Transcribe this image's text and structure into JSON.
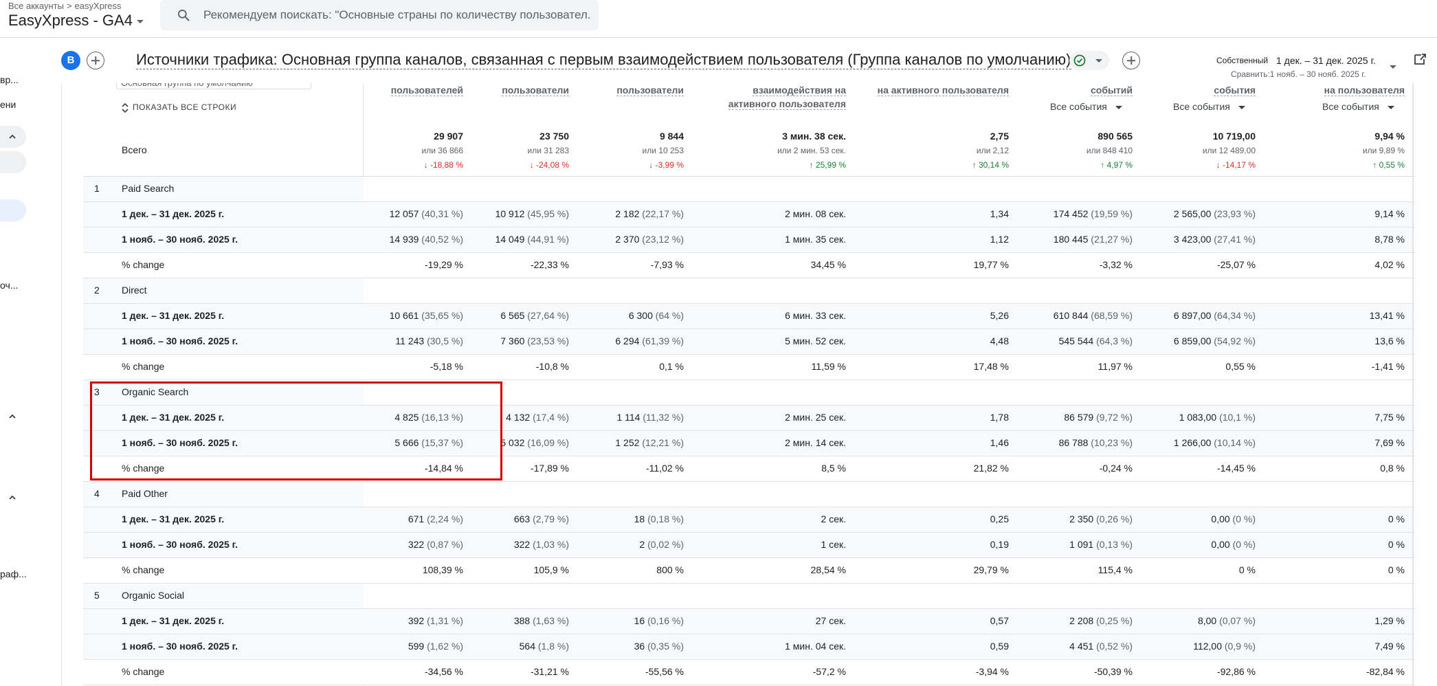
{
  "topbar": {
    "breadcrumb_root": "Все аккаунты",
    "breadcrumb_sep": ">",
    "breadcrumb_account": "easyXpress",
    "property": "EasyXpress - GA4",
    "search_placeholder": "Рекомендуем поискать: \"Основные страны по количеству пользовател..."
  },
  "rail": {
    "labels": [
      "вр...",
      "ени",
      "оч...",
      "раф..."
    ]
  },
  "report": {
    "avatar": "B",
    "title": "Источники трафика: Основная группа каналов, связанная с первым взаимодействием пользователя (Группа каналов по умолчанию)",
    "date_range_label": "Собственный",
    "date_range": "1 дек. – 31 дек. 2025 г.",
    "compare": "Сравнить:1 нояб. – 30 нояб. 2025 г."
  },
  "table": {
    "partial_dimension": "Основная группа по умолчанию",
    "show_all_rows": "ПОКАЗАТЬ ВСЕ СТРОКИ",
    "total_label": "Всего",
    "headers": [
      {
        "lines": [
          "пользователей"
        ]
      },
      {
        "lines": [
          "пользователи"
        ]
      },
      {
        "lines": [
          "пользователи"
        ]
      },
      {
        "lines": [
          "взаимодействия на",
          "активного пользователя"
        ]
      },
      {
        "lines": [
          "на активного пользователя"
        ]
      },
      {
        "lines": [
          "событий"
        ],
        "dropdown": "Все события"
      },
      {
        "lines": [
          "события"
        ],
        "dropdown": "Все события"
      },
      {
        "lines": [
          "на пользователя"
        ],
        "dropdown": "Все события"
      }
    ],
    "totals": [
      {
        "value": "29 907",
        "prev": "или 36 866",
        "change": "↓ -18,88 %",
        "dir": "down"
      },
      {
        "value": "23 750",
        "prev": "или 31 283",
        "change": "↓ -24,08 %",
        "dir": "down"
      },
      {
        "value": "9 844",
        "prev": "или 10 253",
        "change": "↓ -3,99 %",
        "dir": "down"
      },
      {
        "value": "3 мин. 38 сек.",
        "prev": "или 2 мин. 53 сек.",
        "change": "↑ 25,99 %",
        "dir": "up"
      },
      {
        "value": "2,75",
        "prev": "или 2,12",
        "change": "↑ 30,14 %",
        "dir": "up"
      },
      {
        "value": "890 565",
        "prev": "или 848 410",
        "change": "↑ 4,97 %",
        "dir": "up"
      },
      {
        "value": "10 719,00",
        "prev": "или 12 489,00",
        "change": "↓ -14,17 %",
        "dir": "down"
      },
      {
        "value": "9,94 %",
        "prev": "или 9,89 %",
        "change": "↑ 0,55 %",
        "dir": "up"
      }
    ],
    "groups": [
      {
        "num": "1",
        "name": "Paid Search",
        "rows": [
          {
            "label": "1 дек. – 31 дек. 2025 г.",
            "cells": [
              [
                "12 057",
                "(40,31 %)"
              ],
              [
                "10 912",
                "(45,95 %)"
              ],
              [
                "2 182",
                "(22,17 %)"
              ],
              [
                "2 мин. 08 сек.",
                ""
              ],
              [
                "1,34",
                ""
              ],
              [
                "174 452",
                "(19,59 %)"
              ],
              [
                "2 565,00",
                "(23,93 %)"
              ],
              [
                "9,14 %",
                ""
              ]
            ]
          },
          {
            "label": "1 нояб. – 30 нояб. 2025 г.",
            "cells": [
              [
                "14 939",
                "(40,52 %)"
              ],
              [
                "14 049",
                "(44,91 %)"
              ],
              [
                "2 370",
                "(23,12 %)"
              ],
              [
                "1 мин. 35 сек.",
                ""
              ],
              [
                "1,12",
                ""
              ],
              [
                "180 445",
                "(21,27 %)"
              ],
              [
                "3 423,00",
                "(27,41 %)"
              ],
              [
                "8,78 %",
                ""
              ]
            ]
          },
          {
            "label": "% change",
            "cells": [
              [
                "-19,29 %",
                ""
              ],
              [
                "-22,33 %",
                ""
              ],
              [
                "-7,93 %",
                ""
              ],
              [
                "34,45 %",
                ""
              ],
              [
                "19,77 %",
                ""
              ],
              [
                "-3,32 %",
                ""
              ],
              [
                "-25,07 %",
                ""
              ],
              [
                "4,02 %",
                ""
              ]
            ]
          }
        ]
      },
      {
        "num": "2",
        "name": "Direct",
        "rows": [
          {
            "label": "1 дек. – 31 дек. 2025 г.",
            "cells": [
              [
                "10 661",
                "(35,65 %)"
              ],
              [
                "6 565",
                "(27,64 %)"
              ],
              [
                "6 300",
                "(64 %)"
              ],
              [
                "6 мин. 33 сек.",
                ""
              ],
              [
                "5,26",
                ""
              ],
              [
                "610 844",
                "(68,59 %)"
              ],
              [
                "6 897,00",
                "(64,34 %)"
              ],
              [
                "13,41 %",
                ""
              ]
            ]
          },
          {
            "label": "1 нояб. – 30 нояб. 2025 г.",
            "cells": [
              [
                "11 243",
                "(30,5 %)"
              ],
              [
                "7 360",
                "(23,53 %)"
              ],
              [
                "6 294",
                "(61,39 %)"
              ],
              [
                "5 мин. 52 сек.",
                ""
              ],
              [
                "4,48",
                ""
              ],
              [
                "545 544",
                "(64,3 %)"
              ],
              [
                "6 859,00",
                "(54,92 %)"
              ],
              [
                "13,6 %",
                ""
              ]
            ]
          },
          {
            "label": "% change",
            "cells": [
              [
                "-5,18 %",
                ""
              ],
              [
                "-10,8 %",
                ""
              ],
              [
                "0,1 %",
                ""
              ],
              [
                "11,59 %",
                ""
              ],
              [
                "17,48 %",
                ""
              ],
              [
                "11,97 %",
                ""
              ],
              [
                "0,55 %",
                ""
              ],
              [
                "-1,41 %",
                ""
              ]
            ]
          }
        ]
      },
      {
        "num": "3",
        "name": "Organic Search",
        "rows": [
          {
            "label": "1 дек. – 31 дек. 2025 г.",
            "cells": [
              [
                "4 825",
                "(16,13 %)"
              ],
              [
                "4 132",
                "(17,4 %)"
              ],
              [
                "1 114",
                "(11,32 %)"
              ],
              [
                "2 мин. 25 сек.",
                ""
              ],
              [
                "1,78",
                ""
              ],
              [
                "86 579",
                "(9,72 %)"
              ],
              [
                "1 083,00",
                "(10,1 %)"
              ],
              [
                "7,75 %",
                ""
              ]
            ]
          },
          {
            "label": "1 нояб. – 30 нояб. 2025 г.",
            "cells": [
              [
                "5 666",
                "(15,37 %)"
              ],
              [
                "5 032",
                "(16,09 %)"
              ],
              [
                "1 252",
                "(12,21 %)"
              ],
              [
                "2 мин. 14 сек.",
                ""
              ],
              [
                "1,46",
                ""
              ],
              [
                "86 788",
                "(10,23 %)"
              ],
              [
                "1 266,00",
                "(10,14 %)"
              ],
              [
                "7,69 %",
                ""
              ]
            ]
          },
          {
            "label": "% change",
            "cells": [
              [
                "-14,84 %",
                ""
              ],
              [
                "-17,89 %",
                ""
              ],
              [
                "-11,02 %",
                ""
              ],
              [
                "8,5 %",
                ""
              ],
              [
                "21,82 %",
                ""
              ],
              [
                "-0,24 %",
                ""
              ],
              [
                "-14,45 %",
                ""
              ],
              [
                "0,8 %",
                ""
              ]
            ]
          }
        ]
      },
      {
        "num": "4",
        "name": "Paid Other",
        "rows": [
          {
            "label": "1 дек. – 31 дек. 2025 г.",
            "cells": [
              [
                "671",
                "(2,24 %)"
              ],
              [
                "663",
                "(2,79 %)"
              ],
              [
                "18",
                "(0,18 %)"
              ],
              [
                "2 сек.",
                ""
              ],
              [
                "0,25",
                ""
              ],
              [
                "2 350",
                "(0,26 %)"
              ],
              [
                "0,00",
                "(0 %)"
              ],
              [
                "0 %",
                ""
              ]
            ]
          },
          {
            "label": "1 нояб. – 30 нояб. 2025 г.",
            "cells": [
              [
                "322",
                "(0,87 %)"
              ],
              [
                "322",
                "(1,03 %)"
              ],
              [
                "2",
                "(0,02 %)"
              ],
              [
                "1 сек.",
                ""
              ],
              [
                "0,19",
                ""
              ],
              [
                "1 091",
                "(0,13 %)"
              ],
              [
                "0,00",
                "(0 %)"
              ],
              [
                "0 %",
                ""
              ]
            ]
          },
          {
            "label": "% change",
            "cells": [
              [
                "108,39 %",
                ""
              ],
              [
                "105,9 %",
                ""
              ],
              [
                "800 %",
                ""
              ],
              [
                "28,54 %",
                ""
              ],
              [
                "29,79 %",
                ""
              ],
              [
                "115,4 %",
                ""
              ],
              [
                "0 %",
                ""
              ],
              [
                "0 %",
                ""
              ]
            ]
          }
        ]
      },
      {
        "num": "5",
        "name": "Organic Social",
        "rows": [
          {
            "label": "1 дек. – 31 дек. 2025 г.",
            "cells": [
              [
                "392",
                "(1,31 %)"
              ],
              [
                "388",
                "(1,63 %)"
              ],
              [
                "16",
                "(0,16 %)"
              ],
              [
                "27 сек.",
                ""
              ],
              [
                "0,57",
                ""
              ],
              [
                "2 208",
                "(0,25 %)"
              ],
              [
                "8,00",
                "(0,07 %)"
              ],
              [
                "1,29 %",
                ""
              ]
            ]
          },
          {
            "label": "1 нояб. – 30 нояб. 2025 г.",
            "cells": [
              [
                "599",
                "(1,62 %)"
              ],
              [
                "564",
                "(1,8 %)"
              ],
              [
                "36",
                "(0,35 %)"
              ],
              [
                "1 мин. 04 сек.",
                ""
              ],
              [
                "0,59",
                ""
              ],
              [
                "4 451",
                "(0,52 %)"
              ],
              [
                "112,00",
                "(0,9 %)"
              ],
              [
                "7,49 %",
                ""
              ]
            ]
          },
          {
            "label": "% change",
            "cells": [
              [
                "-34,56 %",
                ""
              ],
              [
                "-31,21 %",
                ""
              ],
              [
                "-55,56 %",
                ""
              ],
              [
                "-57,2 %",
                ""
              ],
              [
                "-3,94 %",
                ""
              ],
              [
                "-50,39 %",
                ""
              ],
              [
                "-92,86 %",
                ""
              ],
              [
                "-82,84 %",
                ""
              ]
            ]
          }
        ]
      }
    ]
  },
  "colors": {
    "accent": "#1a73e8",
    "negative": "#d93025",
    "positive": "#188038",
    "highlight_box": "#d50000"
  }
}
